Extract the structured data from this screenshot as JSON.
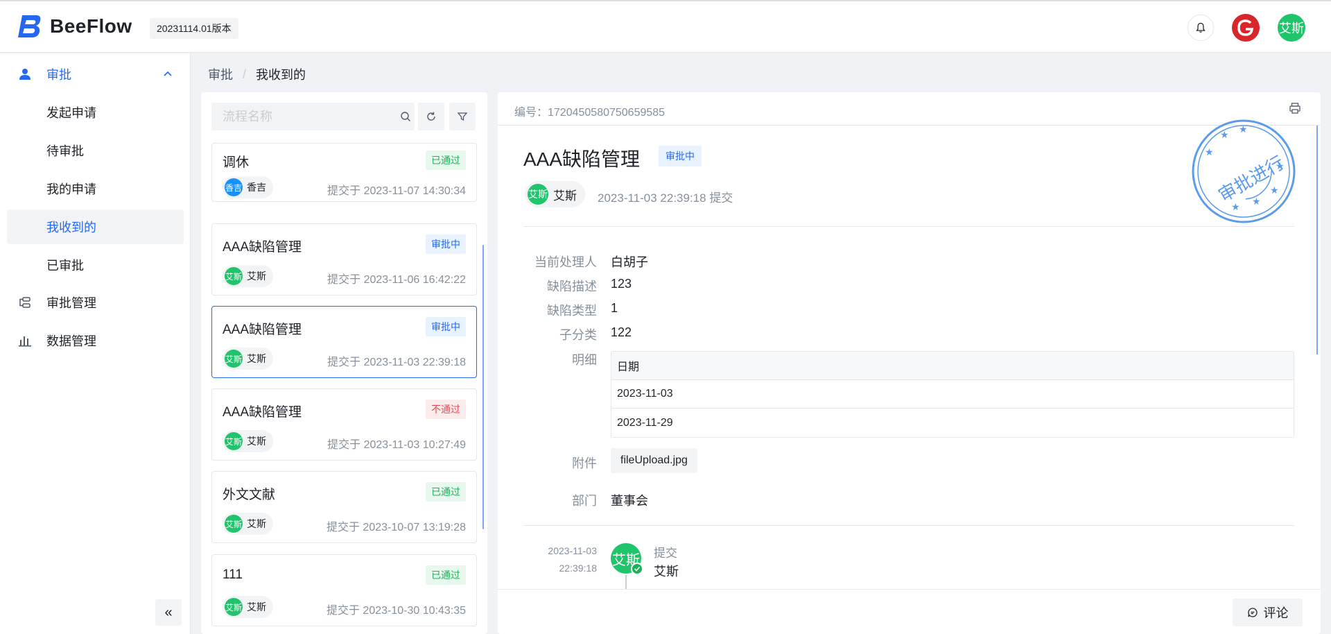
{
  "header": {
    "app_name": "BeeFlow",
    "version": "20231114.01版本",
    "user_avatar_text": "艾斯"
  },
  "sidebar": {
    "groups": [
      {
        "label": "审批"
      },
      {
        "label": "审批管理"
      },
      {
        "label": "数据管理"
      }
    ],
    "sub_items": [
      {
        "label": "发起申请"
      },
      {
        "label": "待审批"
      },
      {
        "label": "我的申请"
      },
      {
        "label": "我收到的"
      },
      {
        "label": "已审批"
      }
    ],
    "collapse_label": "«"
  },
  "breadcrumb": {
    "root": "审批",
    "separator": "/",
    "current": "我收到的"
  },
  "list": {
    "search_placeholder": "流程名称",
    "cards": [
      {
        "title": "调休",
        "status": "已通过",
        "user": "香吉",
        "avatar": "香吉",
        "time": "提交于 2023-11-07 14:30:34"
      },
      {
        "title": "AAA缺陷管理",
        "status": "审批中",
        "user": "艾斯",
        "avatar": "艾斯",
        "time": "提交于 2023-11-06 16:42:22"
      },
      {
        "title": "AAA缺陷管理",
        "status": "审批中",
        "user": "艾斯",
        "avatar": "艾斯",
        "time": "提交于 2023-11-03 22:39:18"
      },
      {
        "title": "AAA缺陷管理",
        "status": "不通过",
        "user": "艾斯",
        "avatar": "艾斯",
        "time": "提交于 2023-11-03 10:27:49"
      },
      {
        "title": "外文文献",
        "status": "已通过",
        "user": "艾斯",
        "avatar": "艾斯",
        "time": "提交于 2023-10-07 13:19:28"
      },
      {
        "title": "111",
        "status": "已通过",
        "user": "艾斯",
        "avatar": "艾斯",
        "time": "提交于 2023-10-30 10:43:35"
      }
    ]
  },
  "detail": {
    "number": "编号：1720450580750659585",
    "title": "AAA缺陷管理",
    "status": "审批中",
    "user": "艾斯",
    "avatar": "艾斯",
    "submit_time": "2023-11-03 22:39:18 提交",
    "stamp_text": "审批进行",
    "fields": {
      "handler_label": "当前处理人",
      "handler_value": "白胡子",
      "desc_label": "缺陷描述",
      "desc_value": "123",
      "type_label": "缺陷类型",
      "type_value": "1",
      "subcat_label": "子分类",
      "subcat_value": "122",
      "detail_label": "明细",
      "table_header": "日期",
      "table_rows": [
        "2023-11-03",
        "2023-11-29"
      ],
      "attach_label": "附件",
      "attach_value": "fileUpload.jpg",
      "dept_label": "部门",
      "dept_value": "董事会"
    },
    "timeline": {
      "date": "2023-11-03",
      "time": "22:39:18",
      "avatar": "艾斯",
      "action": "提交",
      "user": "艾斯"
    },
    "comment_label": "评论"
  },
  "colors": {
    "accent": "#2468f2",
    "pass": "#1fb15a",
    "reject": "#e34d59",
    "avatar_green": "#1fc46b",
    "avatar_blue": "#1890ff"
  }
}
